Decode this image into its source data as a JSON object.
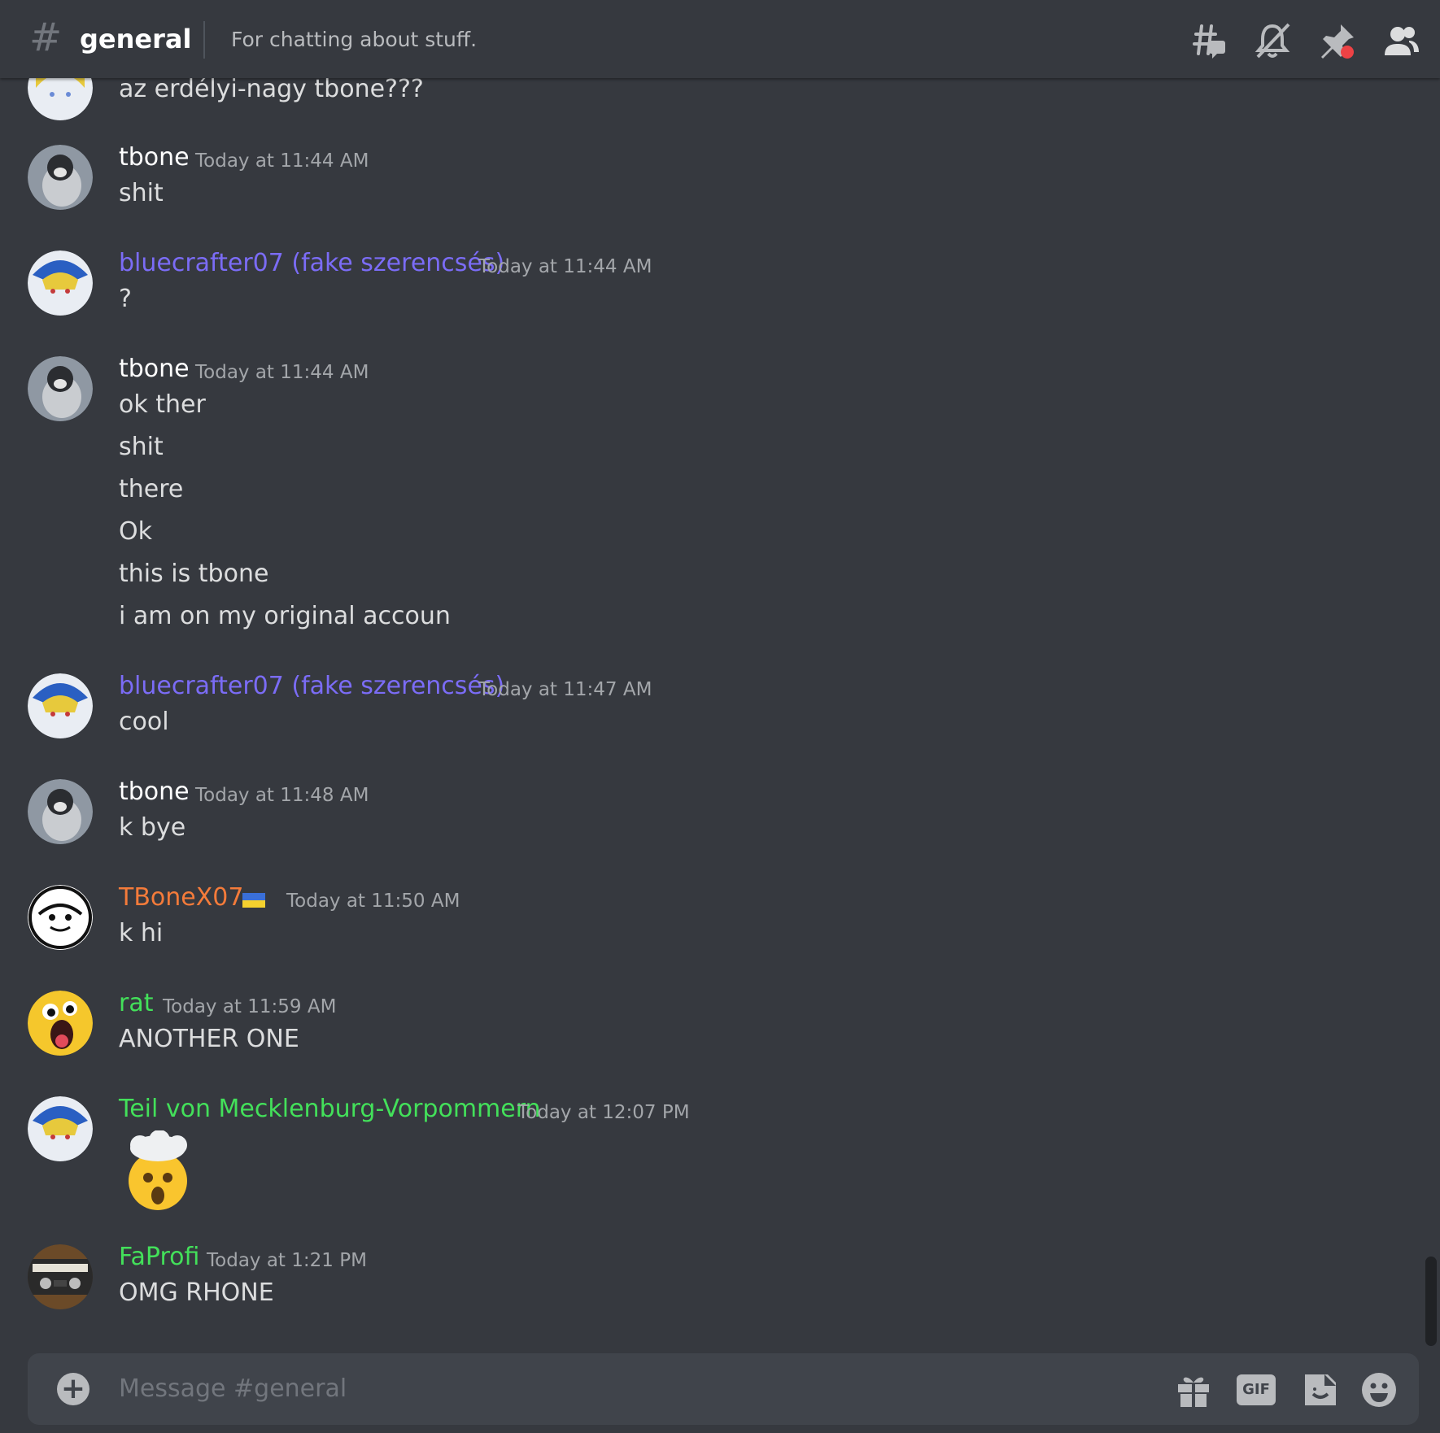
{
  "channel": {
    "name": "general",
    "topic": "For chatting about stuff."
  },
  "header_icons": [
    "threads-icon",
    "mute-bell-icon",
    "pin-icon",
    "member-list-icon"
  ],
  "colors": {
    "background": "#36393f",
    "composer": "#40444b",
    "tbone": "#ffffff",
    "bluecrafter": "#7b6cf6",
    "tbonex07": "#f47b3a",
    "rat": "#43e05a",
    "teil": "#43e05a",
    "faprofi": "#43e05a",
    "timestamp": "#a3a6aa",
    "text": "#dcddde"
  },
  "messages": [
    {
      "author": "",
      "timestamp": "",
      "lines": [
        "az erdélyi-nagy tbone???"
      ]
    },
    {
      "author": "tbone",
      "timestamp": "Today at 11:44 AM",
      "lines": [
        "shit"
      ]
    },
    {
      "author": "bluecrafter07 (fake szerencsés)",
      "timestamp": "Today at 11:44 AM",
      "lines": [
        "?"
      ]
    },
    {
      "author": "tbone",
      "timestamp": "Today at 11:44 AM",
      "lines": [
        "ok ther",
        "shit",
        "there",
        "Ok",
        "this is tbone",
        "i am on my original accoun"
      ]
    },
    {
      "author": "bluecrafter07 (fake szerencsés)",
      "timestamp": "Today at 11:47 AM",
      "lines": [
        "cool"
      ]
    },
    {
      "author": "tbone",
      "timestamp": "Today at 11:48 AM",
      "lines": [
        "k bye"
      ]
    },
    {
      "author": "TBoneX07",
      "timestamp": "Today at 11:50 AM",
      "lines": [
        "k hi"
      ],
      "badge": "ukraine-flag-icon"
    },
    {
      "author": "rat",
      "timestamp": "Today at 11:59 AM",
      "lines": [
        "ANOTHER ONE"
      ]
    },
    {
      "author": "Teil von Mecklenburg-Vorpommern",
      "timestamp": "Today at 12:07 PM",
      "lines": [],
      "emoji": "exploding-head-emoji"
    },
    {
      "author": "FaProfi",
      "timestamp": "Today at 1:21 PM",
      "lines": [
        "OMG RHONE"
      ]
    }
  ],
  "composer": {
    "placeholder": "Message #general",
    "icons": [
      "add-attachment-icon",
      "gift-icon",
      "gif-icon",
      "sticker-icon",
      "emoji-icon"
    ],
    "gif_label": "GIF"
  }
}
